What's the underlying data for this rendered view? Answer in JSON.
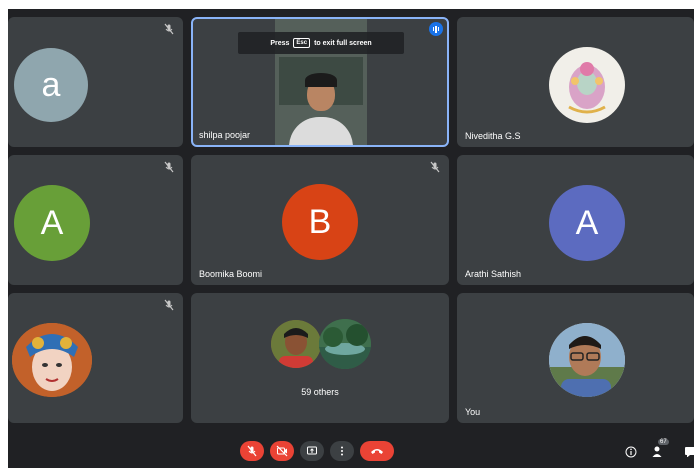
{
  "banner": {
    "press": "Press",
    "key": "Esc",
    "suffix": "to exit full screen"
  },
  "tiles": {
    "t1": {
      "initial": "a",
      "color": "#8fa6ae"
    },
    "t2": {
      "name": "shilpa poojar"
    },
    "t3": {
      "name": "Niveditha G.S"
    },
    "t4": {
      "initial": "A",
      "color": "#689f38"
    },
    "t5": {
      "initial": "B",
      "name": "Boomika Boomi",
      "color": "#d84315"
    },
    "t6": {
      "initial": "A",
      "name": "Arathi Sathish",
      "color": "#5c6bc0"
    },
    "t8": {
      "others": "59 others"
    },
    "t9": {
      "name": "You"
    }
  },
  "participants_count": "67",
  "icons": {
    "mic": "mic-off-icon",
    "cam": "camera-off-icon",
    "present": "present-screen-icon",
    "more": "more-options-icon",
    "leave": "end-call-icon",
    "info": "info-icon",
    "people": "people-icon",
    "chat": "chat-icon",
    "speaking": "speaking-indicator-icon"
  }
}
